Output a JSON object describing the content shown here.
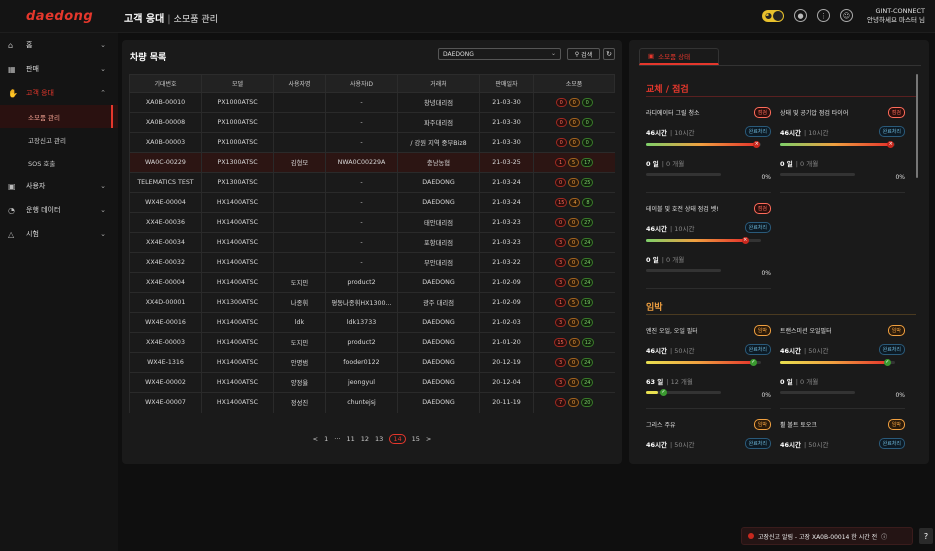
{
  "header": {
    "logo": "daedong",
    "title": "고객 응대",
    "separator": "|",
    "subtitle": "소모품 관리",
    "company": "GINT-CONNECT",
    "greeting": "안녕하세요 마스터 님"
  },
  "sidebar": {
    "items": [
      {
        "label": "홈"
      },
      {
        "label": "판매"
      },
      {
        "label": "고객 응대"
      },
      {
        "label": "사용자"
      },
      {
        "label": "운행 데이터"
      },
      {
        "label": "시험"
      }
    ],
    "sub": [
      {
        "label": "소모품 관리"
      },
      {
        "label": "고장신고 관리"
      },
      {
        "label": "SOS 호출"
      }
    ]
  },
  "vehicle_list": {
    "title": "차량 목록",
    "select_value": "DAEDONG",
    "search_label": "검색",
    "columns": [
      "기대번호",
      "모델",
      "사용자명",
      "사용자ID",
      "거래처",
      "판매일자",
      "소모품"
    ],
    "rows": [
      {
        "id": "XA0B-00010",
        "model": "PX1000ATSC",
        "user": "",
        "uid": "-",
        "dealer": "창녕대리점",
        "date": "21-03-30",
        "b": [
          "0",
          "0",
          "0"
        ]
      },
      {
        "id": "XA0B-00008",
        "model": "PX1000ATSC",
        "user": "",
        "uid": "-",
        "dealer": "파주대리점",
        "date": "21-03-30",
        "b": [
          "0",
          "0",
          "0"
        ]
      },
      {
        "id": "XA0B-00003",
        "model": "PX1000ATSC",
        "user": "",
        "uid": "-",
        "dealer": "/ 강원 지역  중부Biz8",
        "date": "21-03-30",
        "b": [
          "0",
          "0",
          "0"
        ]
      },
      {
        "id": "WA0C-00229",
        "model": "PX1300ATSC",
        "user": "김형모",
        "uid": "NWA0C00229A",
        "dealer": "충남농협",
        "date": "21-03-25",
        "b": [
          "1",
          "5",
          "17"
        ]
      },
      {
        "id": "TELEMATICS TEST",
        "model": "PX1300ATSC",
        "user": "",
        "uid": "-",
        "dealer": "DAEDONG",
        "date": "21-03-24",
        "b": [
          "0",
          "0",
          "25"
        ]
      },
      {
        "id": "WX4E-00004",
        "model": "HX1400ATSC",
        "user": "",
        "uid": "-",
        "dealer": "DAEDONG",
        "date": "21-03-24",
        "b": [
          "15",
          "4",
          "8"
        ]
      },
      {
        "id": "XX4E-00036",
        "model": "HX1400ATSC",
        "user": "",
        "uid": "-",
        "dealer": "태안대리점",
        "date": "21-03-23",
        "b": [
          "0",
          "0",
          "27"
        ]
      },
      {
        "id": "XX4E-00034",
        "model": "HX1400ATSC",
        "user": "",
        "uid": "-",
        "dealer": "포항대리점",
        "date": "21-03-23",
        "b": [
          "3",
          "0",
          "24"
        ]
      },
      {
        "id": "XX4E-00032",
        "model": "HX1400ATSC",
        "user": "",
        "uid": "-",
        "dealer": "부안대리점",
        "date": "21-03-22",
        "b": [
          "3",
          "0",
          "24"
        ]
      },
      {
        "id": "XX4E-00004",
        "model": "HX1400ATSC",
        "user": "도지민",
        "uid": "product2",
        "dealer": "DAEDONG",
        "date": "21-02-09",
        "b": [
          "3",
          "0",
          "24"
        ]
      },
      {
        "id": "XX4D-00001",
        "model": "HX1300ATSC",
        "user": "나종휘",
        "uid": "평동나종휘HX1300...",
        "dealer": "광주 대리점",
        "date": "21-02-09",
        "b": [
          "1",
          "5",
          "19"
        ]
      },
      {
        "id": "WX4E-00016",
        "model": "HX1400ATSC",
        "user": "ldk",
        "uid": "ldk13733",
        "dealer": "DAEDONG",
        "date": "21-02-03",
        "b": [
          "3",
          "0",
          "24"
        ]
      },
      {
        "id": "XX4E-00003",
        "model": "HX1400ATSC",
        "user": "도지민",
        "uid": "product2",
        "dealer": "DAEDONG",
        "date": "21-01-20",
        "b": [
          "15",
          "0",
          "12"
        ]
      },
      {
        "id": "WX4E-1316",
        "model": "HX1400ATSC",
        "user": "안명범",
        "uid": "fooder0122",
        "dealer": "DAEDONG",
        "date": "20-12-19",
        "b": [
          "3",
          "0",
          "24"
        ]
      },
      {
        "id": "WX4E-00002",
        "model": "HX1400ATSC",
        "user": "양정율",
        "uid": "jeongyul",
        "dealer": "DAEDONG",
        "date": "20-12-04",
        "b": [
          "3",
          "0",
          "24"
        ]
      },
      {
        "id": "WX4E-00007",
        "model": "HX1400ATSC",
        "user": "정성진",
        "uid": "chuntejsj",
        "dealer": "DAEDONG",
        "date": "20-11-19",
        "b": [
          "7",
          "0",
          "20"
        ]
      }
    ],
    "pager": [
      "<",
      "1",
      "···",
      "11",
      "12",
      "13",
      "14",
      "15",
      ">"
    ],
    "current_page": "14"
  },
  "consumables": {
    "tab": "소모품 상태",
    "section1": "교체 / 점검",
    "section2": "임박",
    "cards": [
      {
        "name": "라디에이터 그릴 청소",
        "tag": "점검",
        "tagtype": "red",
        "hours": "46시간",
        "total": "10시간",
        "done": "완료처리",
        "hours_fill": 0.95,
        "hdot": "red",
        "days": "0 일",
        "dtotal": "0 개월",
        "pct": "0%",
        "days_fill": 0,
        "ddot": ""
      },
      {
        "name": "상태 및 공기압 점검  타이어",
        "tag": "점검",
        "tagtype": "red",
        "hours": "46시간",
        "total": "10시간",
        "done": "완료처리",
        "hours_fill": 0.95,
        "hdot": "red",
        "days": "0 일",
        "dtotal": "0 개월",
        "pct": "0%",
        "days_fill": 0,
        "ddot": ""
      },
      {
        "name": "테이블 및 호전 상태 점검  벳!",
        "tag": "점검",
        "tagtype": "red",
        "hours": "46시간",
        "total": "10시간",
        "done": "완료처리",
        "hours_fill": 0.85,
        "hdot": "red",
        "days": "0 일",
        "dtotal": "0 개월",
        "pct": "0%",
        "days_fill": 0,
        "ddot": ""
      },
      {
        "name": "엔진 오일, 오일 필터",
        "tag": "임박",
        "tagtype": "amb",
        "hours": "46시간",
        "total": "50시간",
        "done": "완료처리",
        "hours_fill": 0.92,
        "hdot": "green",
        "days": "63 일",
        "dtotal": "12 개월",
        "pct": "0%",
        "days_fill": 0.16,
        "ddot": "green"
      },
      {
        "name": "트랜스미션 오일필터",
        "tag": "임박",
        "tagtype": "amb",
        "hours": "46시간",
        "total": "50시간",
        "done": "완료처리",
        "hours_fill": 0.92,
        "hdot": "green",
        "days": "0 일",
        "dtotal": "0 개월",
        "pct": "0%",
        "days_fill": 0,
        "ddot": ""
      },
      {
        "name": "그리스 주유",
        "tag": "임박",
        "tagtype": "amb",
        "hours": "46시간",
        "total": "50시간",
        "done": "완료처리",
        "hours_fill": 0,
        "hdot": "",
        "days": "",
        "dtotal": "",
        "pct": "",
        "days_fill": 0,
        "ddot": ""
      },
      {
        "name": "휠 볼트 토오크",
        "tag": "임박",
        "tagtype": "amb",
        "hours": "46시간",
        "total": "50시간",
        "done": "완료처리",
        "hours_fill": 0,
        "hdot": "",
        "days": "",
        "dtotal": "",
        "pct": "",
        "days_fill": 0,
        "ddot": ""
      }
    ]
  },
  "toast": {
    "text": "고장신고 알림 - 고장  XA0B-00014  한 시간 전"
  },
  "help": "?"
}
